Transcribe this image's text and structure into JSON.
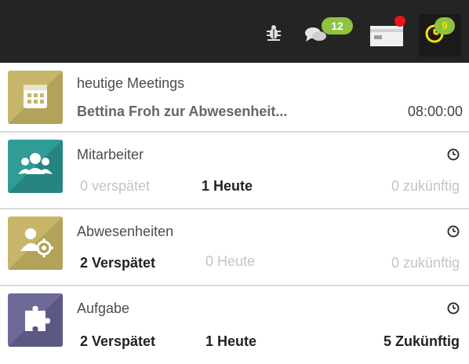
{
  "topbar": {
    "chat_badge": "12",
    "activity_badge": "9"
  },
  "activities": [
    {
      "title": "heutige Meetings",
      "subtitle": "Bettina Froh zur Abwesenheit...",
      "time": "08:00:00",
      "icon": "calendar-icon",
      "color": "#c7b66a"
    },
    {
      "title": "Mitarbeiter",
      "icon": "people-icon",
      "color": "#2f9c96",
      "late": "0 verspätet",
      "today": "1 Heute",
      "future": "0 zukünftig"
    },
    {
      "title": "Abwesenheiten",
      "icon": "person-gear-icon",
      "color": "#c7b66a",
      "late": "2 Verspätet",
      "today": "0 Heute",
      "future": "0 zukünftig"
    },
    {
      "title": "Aufgabe",
      "icon": "puzzle-icon",
      "color": "#6e6a98",
      "late": "2 Verspätet",
      "today": "1 Heute",
      "future": "5 Zukünftig"
    }
  ]
}
